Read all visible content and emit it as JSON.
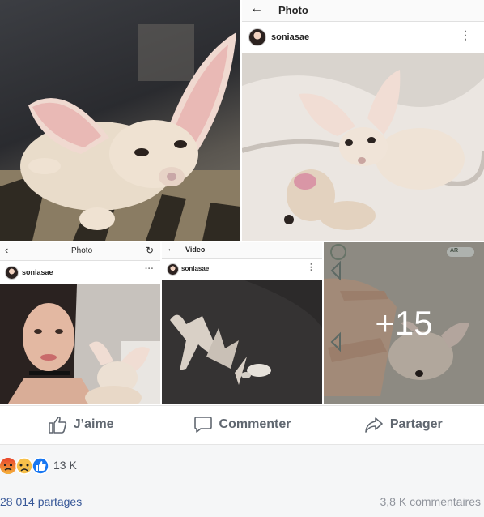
{
  "tiles": {
    "t2": {
      "header_title": "Photo",
      "username": "soniasae"
    },
    "t3": {
      "header_title": "Photo",
      "username": "soniasae"
    },
    "t4": {
      "header_title": "Video",
      "username": "soniasae"
    },
    "t5": {
      "overlay_text": "+15",
      "ar_badge": "AR"
    }
  },
  "actions": {
    "like_label": "J’aime",
    "comment_label": "Commenter",
    "share_label": "Partager"
  },
  "reactions": {
    "count": "13 K",
    "icons": [
      "angry-icon",
      "sad-icon",
      "like-icon"
    ]
  },
  "stats": {
    "shares": "28 014 partages",
    "comments": "3,8 K commentaires"
  },
  "colors": {
    "text_muted": "#606770",
    "stats_bg": "#f5f6f7",
    "like_blue": "#1877f2",
    "angry_orange": "#f0653c",
    "sad_yellow": "#f7c04a"
  }
}
